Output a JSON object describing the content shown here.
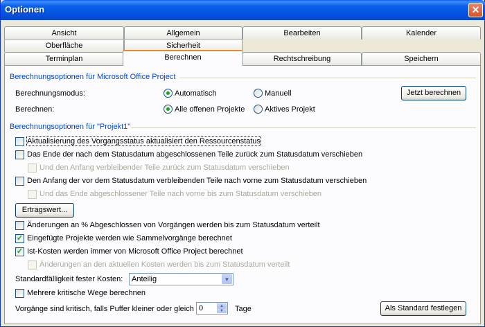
{
  "window": {
    "title": "Optionen",
    "close_glyph": "✕"
  },
  "tabs": {
    "row1": [
      "Ansicht",
      "Allgemein",
      "Bearbeiten",
      "Kalender"
    ],
    "row2": [
      "Oberfläche",
      "Sicherheit"
    ],
    "row3": [
      "Terminplan",
      "Berechnen",
      "Rechtschreibung",
      "Speichern"
    ],
    "active": "Berechnen"
  },
  "project_group": {
    "title": "Berechnungsoptionen für Microsoft Office Project",
    "mode_label": "Berechnungsmodus:",
    "mode_auto": "Automatisch",
    "mode_manual": "Manuell",
    "calc_label": "Berechnen:",
    "calc_all": "Alle offenen Projekte",
    "calc_active": "Aktives Projekt",
    "calc_now_button": "Jetzt berechnen"
  },
  "project1_group": {
    "title": "Berechnungsoptionen für \"Projekt1\"",
    "opt1": "Aktualisierung des Vorgangsstatus aktualisiert den Ressourcenstatus",
    "opt2": "Das Ende der nach dem Statusdatum abgeschlossenen Teile zurück zum Statusdatum verschieben",
    "opt2a": "Und den Anfang verbleibender Teile zurück zum Statusdatum verschieben",
    "opt3": "Den Anfang der vor dem Statusdatum verbleibenden Teile nach vorne zum Statusdatum verschieben",
    "opt3a": "Und das Ende abgeschlossener Teile nach vorne bis zum Statusdatum verschieben",
    "earned_value_button": "Ertragswert...",
    "opt4": "Änderungen an % Abgeschlossen von Vorgängen werden bis zum Statusdatum verteilt",
    "opt5": "Eingefügte Projekte werden wie Sammelvorgänge berechnet",
    "opt6": "Ist-Kosten werden immer von Microsoft Office Project berechnet",
    "opt6a": "Änderungen an den aktuellen Kosten werden bis zum Statusdatum verteilt",
    "fixed_cost_label": "Standardfälligkeit fester Kosten:",
    "fixed_cost_value": "Anteilig",
    "opt7": "Mehrere kritische Wege berechnen",
    "critical_label": "Vorgänge sind kritisch, falls Puffer kleiner oder gleich",
    "critical_value": "0",
    "critical_unit": "Tage",
    "default_button": "Als Standard festlegen"
  },
  "checkmark": "✓",
  "arrow_down": "▼",
  "arrow_up": "▲"
}
